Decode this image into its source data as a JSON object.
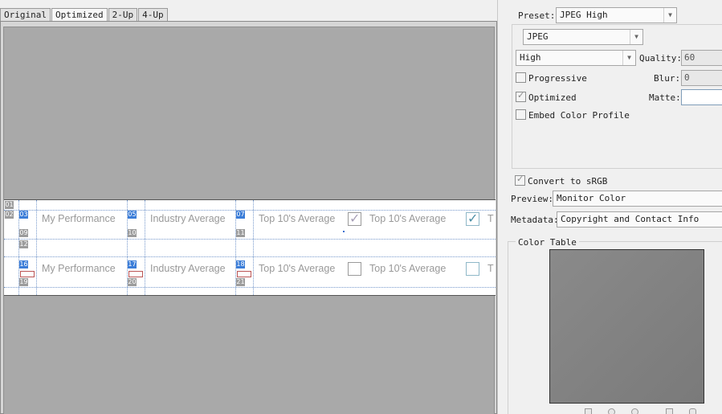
{
  "tabs": [
    {
      "label": "Original"
    },
    {
      "label": "Optimized"
    },
    {
      "label": "2-Up"
    },
    {
      "label": "4-Up"
    }
  ],
  "preview": {
    "row1": [
      "My Performance",
      "Industry Average",
      "Top 10's Average",
      "Top 10's Average",
      "T"
    ],
    "row2": [
      "My Performance",
      "Industry Average",
      "Top 10's Average",
      "Top 10's Average",
      "T"
    ],
    "slice_numbers": [
      "01",
      "02",
      "03",
      "05",
      "07",
      "09",
      "10",
      "11",
      "12",
      "16",
      "17",
      "18",
      "19",
      "20",
      "21"
    ]
  },
  "settings": {
    "preset_label": "Preset:",
    "preset_value": "JPEG High",
    "format_value": "JPEG",
    "quality_level": "High",
    "quality_label": "Quality:",
    "quality_value": "60",
    "progressive_label": "Progressive",
    "blur_label": "Blur:",
    "blur_value": "0",
    "optimized_label": "Optimized",
    "matte_label": "Matte:",
    "embed_label": "Embed Color Profile",
    "convert_label": "Convert to sRGB",
    "preview_label": "Preview:",
    "preview_value": "Monitor Color",
    "metadata_label": "Metadata:",
    "metadata_value": "Copyright and Contact Info",
    "color_table_label": "Color Table"
  },
  "colors": {
    "accent": "#3b7dd8",
    "canvas": "#a9a9a9",
    "swatch": "#808080"
  }
}
